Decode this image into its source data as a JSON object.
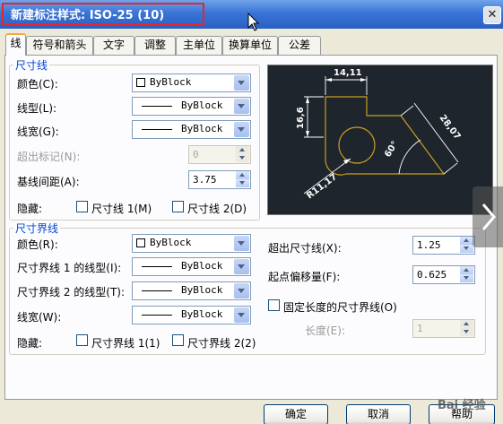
{
  "window": {
    "title": "新建标注样式: ISO-25 (10)",
    "close_glyph": "✕"
  },
  "tabs": [
    {
      "label": "线",
      "active": true
    },
    {
      "label": "符号和箭头"
    },
    {
      "label": "文字"
    },
    {
      "label": "调整"
    },
    {
      "label": "主单位"
    },
    {
      "label": "换算单位"
    },
    {
      "label": "公差"
    }
  ],
  "dimension_lines": {
    "legend": "尺寸线",
    "color_label": "颜色(C):",
    "color_value": "ByBlock",
    "linetype_label": "线型(L):",
    "linetype_value": "ByBlock",
    "lineweight_label": "线宽(G):",
    "lineweight_value": "ByBlock",
    "extend_label": "超出标记(N):",
    "extend_value": "0",
    "baseline_label": "基线间距(A):",
    "baseline_value": "3.75",
    "suppress_label": "隐藏:",
    "suppress_1": "尺寸线 1(M)",
    "suppress_2": "尺寸线 2(D)"
  },
  "extension_lines": {
    "legend": "尺寸界线",
    "color_label": "颜色(R):",
    "color_value": "ByBlock",
    "linetype1_label": "尺寸界线 1 的线型(I):",
    "linetype1_value": "ByBlock",
    "linetype2_label": "尺寸界线 2 的线型(T):",
    "linetype2_value": "ByBlock",
    "lineweight_label": "线宽(W):",
    "lineweight_value": "ByBlock",
    "suppress_label": "隐藏:",
    "suppress_1": "尺寸界线 1(1)",
    "suppress_2": "尺寸界线 2(2)",
    "extend_label": "超出尺寸线(X):",
    "extend_value": "1.25",
    "offset_label": "起点偏移量(F):",
    "offset_value": "0.625",
    "fixed_label": "固定长度的尺寸界线(O)",
    "length_label": "长度(E):",
    "length_value": "1"
  },
  "preview": {
    "dim_top": "14,11",
    "dim_left": "16,6",
    "dim_right": "28,07",
    "dim_angle": "60°",
    "dim_radius": "R11,17"
  },
  "buttons": {
    "ok": "确定",
    "cancel": "取消",
    "help": "帮助"
  },
  "watermark": "Bai 经验",
  "colors": {
    "title_bar": "#3a74d6",
    "legend": "#0046d5",
    "preview_bg": "#1e252c",
    "preview_shape": "#c8a020",
    "highlight_box": "#e0282d"
  }
}
